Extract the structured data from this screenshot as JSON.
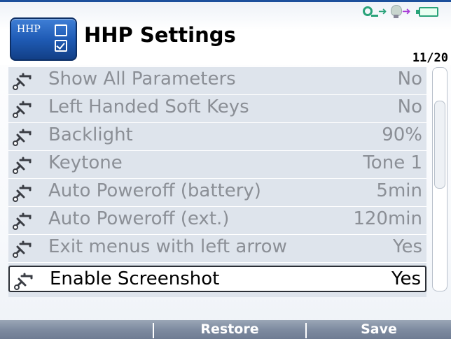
{
  "header": {
    "logo_text": "HHP",
    "title": "HHP Settings",
    "page_counter": "11/20"
  },
  "status": {
    "icons": [
      "connection-icon",
      "arrow-icon",
      "bulb-icon",
      "arrow-icon",
      "battery-icon"
    ],
    "colors": {
      "connection": "#2aa37a",
      "arrow_purple": "#a83bd8",
      "battery": "#2aa37a"
    }
  },
  "list": {
    "items": [
      {
        "label": "Show All Parameters",
        "value": "No"
      },
      {
        "label": "Left Handed Soft Keys",
        "value": "No"
      },
      {
        "label": "Backlight",
        "value": "90%"
      },
      {
        "label": "Keytone",
        "value": "Tone 1"
      },
      {
        "label": "Auto Poweroff (battery)",
        "value": "5min"
      },
      {
        "label": "Auto Poweroff (ext.)",
        "value": "120min"
      },
      {
        "label": "Exit menus with left arrow",
        "value": "Yes"
      },
      {
        "label": "Enable Screenshot",
        "value": "Yes"
      }
    ],
    "selected_index": 7
  },
  "softkeys": {
    "left": "",
    "middle": "Restore",
    "right": "Save"
  }
}
